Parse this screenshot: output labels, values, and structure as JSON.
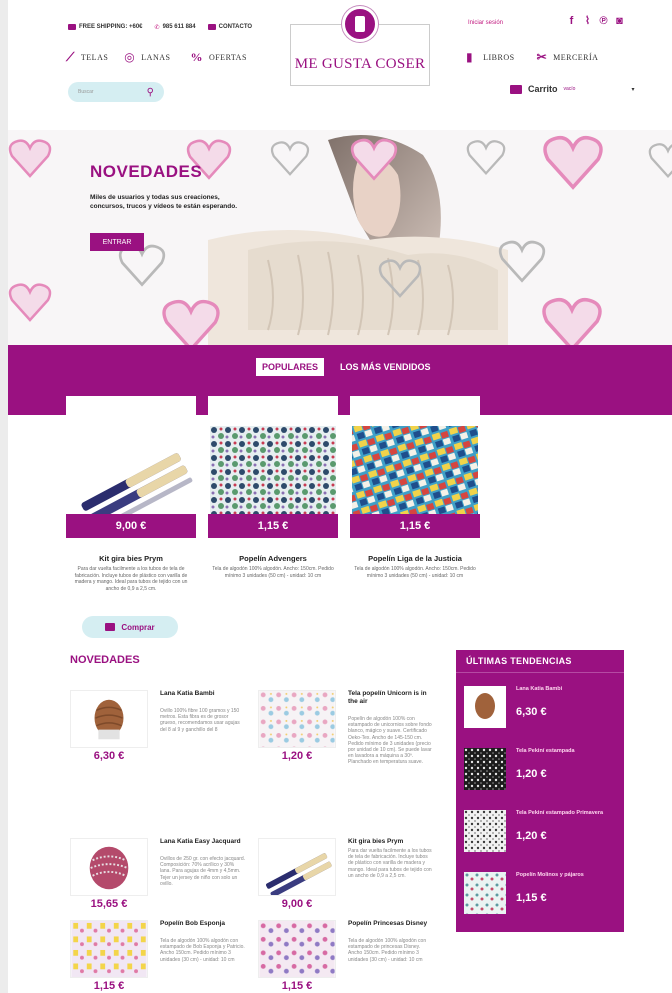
{
  "header": {
    "shipping": "FREE SHIPPING: +60€",
    "phone": "985 611 884",
    "contact": "CONTACTO",
    "login": "Iniciar sesión",
    "logo_text": "ME GUSTA COSER",
    "nav_left": [
      {
        "label": "TELAS",
        "icon": "needle-icon"
      },
      {
        "label": "LANAS",
        "icon": "yarn-icon"
      },
      {
        "label": "OFERTAS",
        "icon": "percent-icon"
      }
    ],
    "nav_right": [
      {
        "label": "LIBROS",
        "icon": "book-icon"
      },
      {
        "label": "MERCERÍA",
        "icon": "scissors-icon"
      }
    ],
    "search_placeholder": "Buscar",
    "cart_label": "Carrito",
    "cart_status": "vacío",
    "accent_color": "#9a1181"
  },
  "hero": {
    "title": "NOVEDADES",
    "text": "Miles de usuarios y todas sus creaciones, concursos, trucos y vídeos te están esperando.",
    "button": "ENTRAR"
  },
  "tabs": [
    "POPULARES",
    "LOS MÁS VENDIDOS"
  ],
  "popular": [
    {
      "name": "Kit gira bies Prym",
      "price": "9,00 €",
      "desc": "Para dar vuelta facilmente a los tubos de tela de fabricación. Incluye tubos de plástico con varilla de madera y mango. Ideal para tubos de tejido con un ancho de 0,9 a 2,5 cm."
    },
    {
      "name": "Popelín Advengers",
      "price": "1,15 €",
      "desc": "Tela de algodón 100% algodón. Ancho: 150cm. Pedido mínimo 3 unidades (50 cm) - unidad: 10 cm"
    },
    {
      "name": "Popelín Liga de la Justicia",
      "price": "1,15 €",
      "desc": "Tela de algodón 100% algodón. Ancho: 150cm. Pedido mínimo 3 unidades (50 cm) - unidad: 10 cm"
    }
  ],
  "buy_button": "Comprar",
  "novedades": {
    "title": "NOVEDADES",
    "items": [
      {
        "name": "Lana Katia Bambi",
        "price": "6,30 €",
        "desc": "Ovillo 100% fibre 100 gramos y 150 metros. Esta fibra es de grosor grueso, recomendamos usar agujas del 8 al 9 y ganchillo del 8"
      },
      {
        "name": "Tela popelín Unicorn is in the air",
        "price": "1,20 €",
        "desc": "Popelín de algodón 100% con estampado de unicornios sobre fondo blanco, mágico y suave. Certificado Oeko-Tex. Ancho de 145-150 cm. Pedido mínimo de 3 unidades (precio por unidad de 10 cm). Se puede lavar en lavadora a máquina a 30º. Planchado en temperatura suave."
      },
      {
        "name": "Lana Katia Easy Jacquard",
        "price": "15,65 €",
        "desc": "Ovillos de 250 gr. con efecto jacquard. Composición: 70% acrílico y 30% lana. Para agujas de 4mm y 4,5mm. Tejer un jersey de niño con solo un ovillo."
      },
      {
        "name": "Kit gira bies Prym",
        "price": "9,00 €",
        "desc": "Para dar vuelta facilmente a los tubos de tela de fabricación. Incluye tubos de plástico con varilla de madera y mango. Ideal para tubos de tejido con un ancho de 0,9 a 2,5 cm."
      },
      {
        "name": "Popelín Bob Esponja",
        "price": "1,15 €",
        "desc": "Tela de algodón 100% algodón con estampado de Bob Esponja y Patricio. Ancho 150cm. Pedido mínimo 3 unidades (30 cm) - unidad: 10 cm"
      },
      {
        "name": "Popelín Princesas Disney",
        "price": "1,15 €",
        "desc": "Tela de algodón 100% algodón con estampado de princesas Disney. Ancho 150cm. Pedido mínimo 3 unidades (30 cm) - unidad: 10 cm"
      }
    ]
  },
  "tendencias": {
    "title": "ÚLTIMAS TENDENCIAS",
    "items": [
      {
        "name": "Lana Katia Bambi",
        "price": "6,30 €"
      },
      {
        "name": "Tela Pekiní estampada",
        "price": "1,20 €"
      },
      {
        "name": "Tela Pekiní estampado Primavera",
        "price": "1,20 €"
      },
      {
        "name": "Popelín Molinos y pájaros",
        "price": "1,15 €"
      }
    ]
  }
}
